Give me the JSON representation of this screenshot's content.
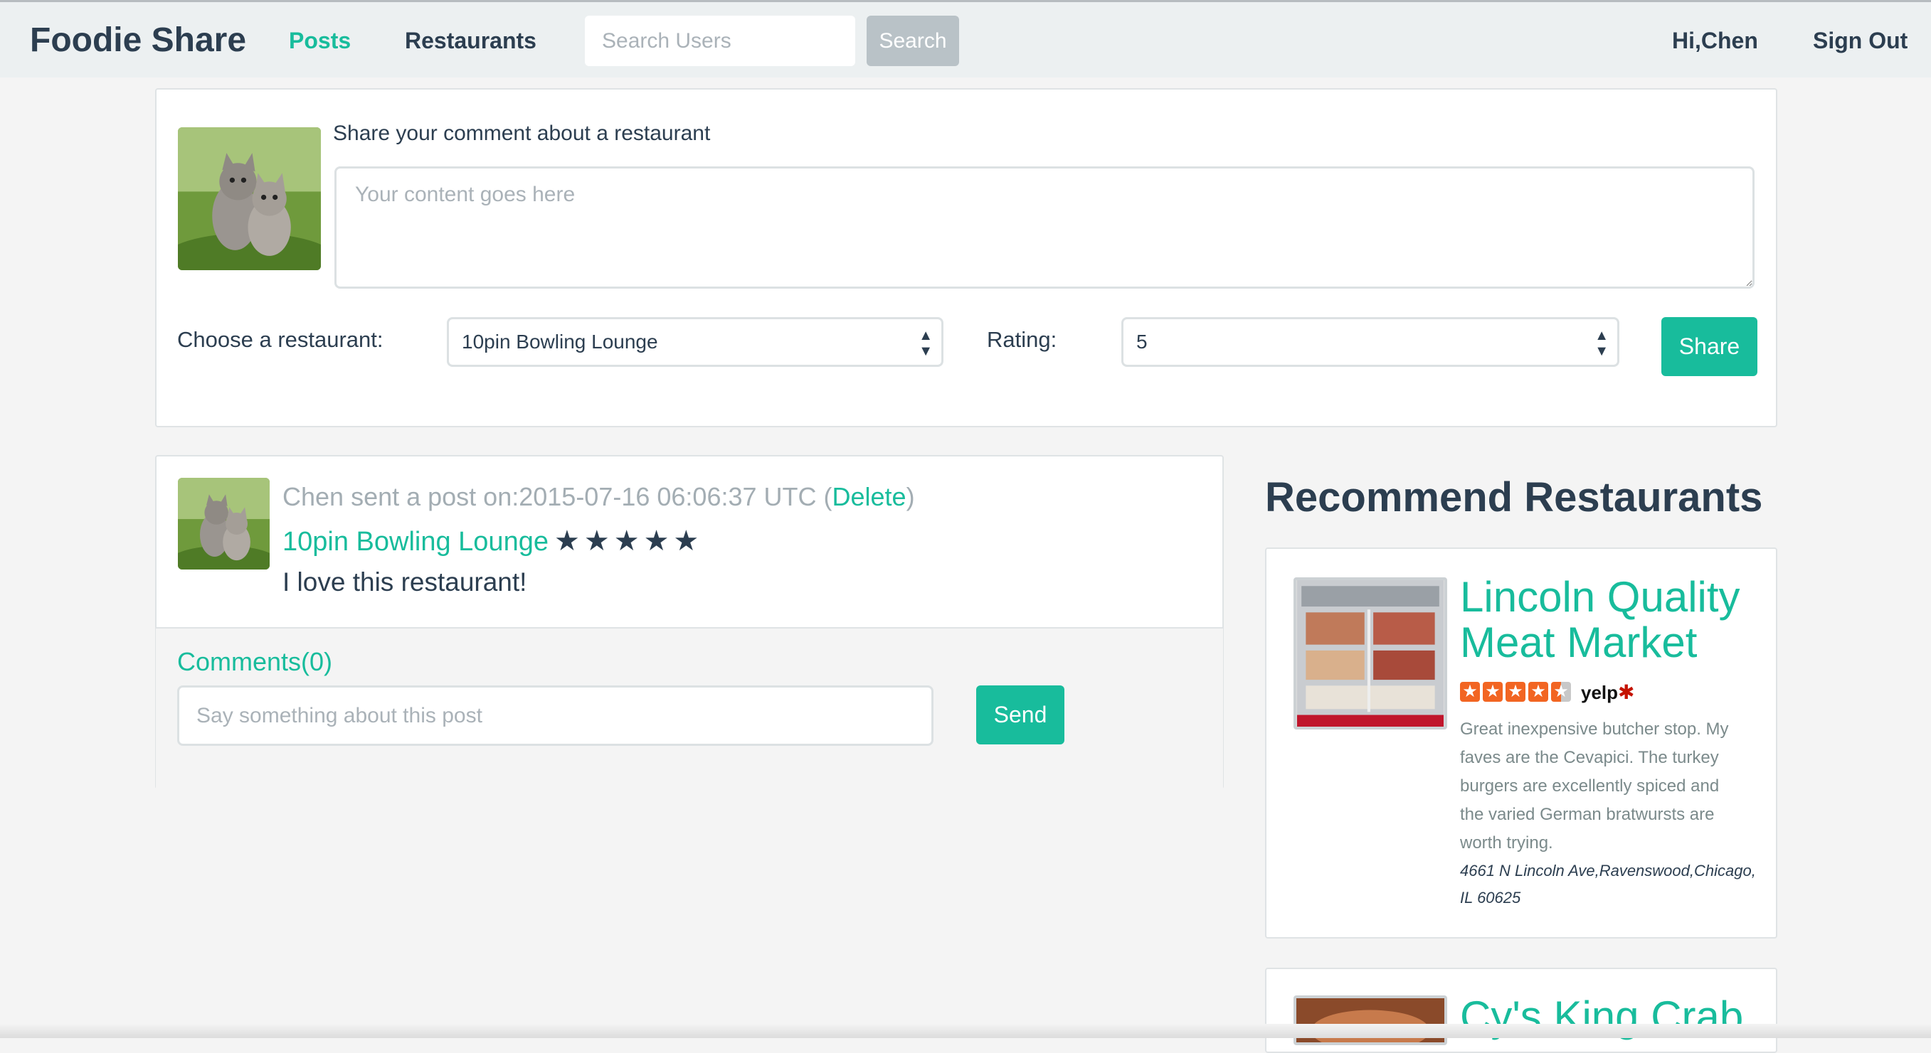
{
  "navbar": {
    "brand": "Foodie Share",
    "links": [
      {
        "label": "Posts",
        "active": true
      },
      {
        "label": "Restaurants",
        "active": false
      }
    ],
    "search_placeholder": "Search Users",
    "search_button": "Search",
    "greeting": "Hi,Chen",
    "sign_out": "Sign Out"
  },
  "compose": {
    "label": "Share your comment about a restaurant",
    "placeholder": "Your content goes here",
    "restaurant_label": "Choose a restaurant:",
    "restaurant_selected": "10pin Bowling Lounge",
    "rating_label": "Rating:",
    "rating_selected": "5",
    "share_button": "Share"
  },
  "post": {
    "meta_prefix": "Chen sent a post on:2015-07-16 06:06:37 UTC (",
    "delete_label": "Delete",
    "meta_suffix": ")",
    "restaurant": "10pin Bowling Lounge",
    "stars": "★★★★★",
    "star_count": 5,
    "content": "I love this restaurant!",
    "comments_title": "Comments(0)",
    "comment_placeholder": "Say something about this post",
    "send_button": "Send"
  },
  "recommend": {
    "heading": "Recommend Restaurants",
    "items": [
      {
        "name": "Lincoln Quality Meat Market",
        "rating": 4.5,
        "rating_source": "yelp",
        "description": "Great inexpensive butcher stop. My faves are the Cevapici. The turkey burgers are excellently spiced and the varied German bratwursts are worth trying.",
        "address": "4661 N Lincoln Ave,Ravenswood,Chicago, IL 60625"
      },
      {
        "name": "Cy's King Crab"
      }
    ]
  },
  "colors": {
    "accent": "#18bc9c",
    "text": "#2c3e50",
    "navbar_bg": "#ecf0f1"
  }
}
